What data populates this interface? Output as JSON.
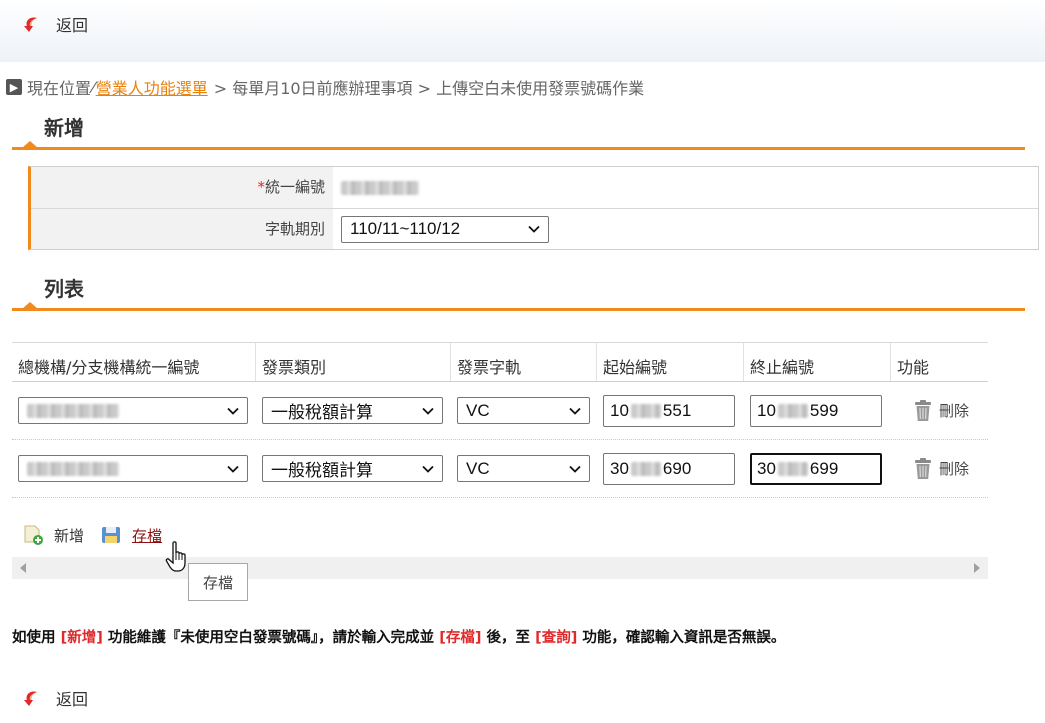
{
  "nav": {
    "back_label": "返回"
  },
  "breadcrumb": {
    "prefix": "現在位置",
    "link": "營業人功能選單",
    "rest": " > 每單月10日前應辦理事項 > 上傳空白未使用發票號碼作業"
  },
  "sections": {
    "add_title": "新增",
    "list_title": "列表"
  },
  "form": {
    "tax_id_required_mark": "*",
    "tax_id_label": "統一編號",
    "period_label": "字軌期別",
    "period_value": "110/11~110/12"
  },
  "table": {
    "headers": [
      "總機構/分支機構統一編號",
      "發票類別",
      "發票字軌",
      "起始編號",
      "終止編號",
      "功能"
    ],
    "rows": [
      {
        "category": "一般稅額計算",
        "track": "VC",
        "start_prefix": "10",
        "start_suffix": "551",
        "end_prefix": "10",
        "end_suffix": "599",
        "delete_label": "刪除"
      },
      {
        "category": "一般稅額計算",
        "track": "VC",
        "start_prefix": "30",
        "start_suffix": "690",
        "end_prefix": "30",
        "end_suffix": "699",
        "delete_label": "刪除"
      }
    ]
  },
  "toolbar": {
    "add_label": "新增",
    "save_label": "存檔"
  },
  "tooltip": {
    "text": "存檔"
  },
  "notice": {
    "p1": "如使用 ",
    "h1": "[新增]",
    "p2": " 功能維護『未使用空白發票號碼』，請於輸入完成並 ",
    "h2": "[存檔]",
    "p3": " 後，至 ",
    "h3": "[查詢]",
    "p4": " 功能，確認輸入資訊是否無誤。"
  },
  "colors": {
    "accent": "#f08a1c",
    "link": "#e8820c",
    "highlight": "#e0292b",
    "save_link": "#8b0f10"
  }
}
